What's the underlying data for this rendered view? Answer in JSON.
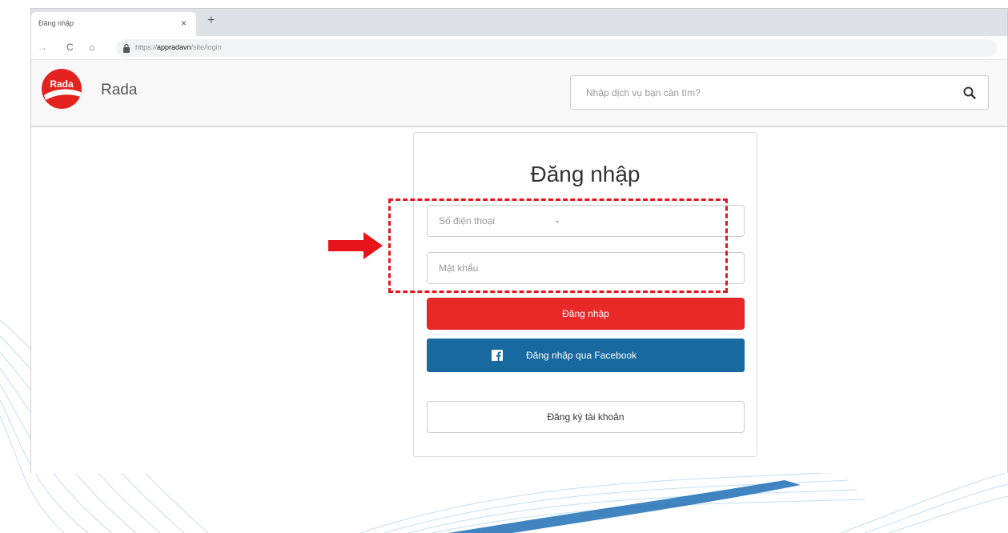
{
  "browser": {
    "tab_title": "Đăng nhập",
    "tab_close": "×",
    "new_tab": "+",
    "nav": {
      "back": "→",
      "reload": "C",
      "home": "⌂"
    },
    "url": {
      "prefix": "https://",
      "host": "appradavn",
      "path": "/site/login"
    }
  },
  "header": {
    "brand": "Rada",
    "logo_text": "Rada",
    "search": {
      "placeholder": "Nhập dịch vụ bạn cần tìm?"
    }
  },
  "login": {
    "title": "Đăng nhập",
    "phone_placeholder": "Số điện thoại",
    "password_placeholder": "Mật khẩu",
    "stray_mark": "`",
    "login_button": "Đăng nhập",
    "facebook_button": "Đăng nhập qua Facebook",
    "register_button": "Đăng ký tài khoản"
  },
  "icons": {
    "search": "search-icon",
    "lock": "lock-icon",
    "facebook": "facebook-icon",
    "logo": "rada-logo"
  },
  "colors": {
    "primary_red": "#e92828",
    "facebook_blue": "#1769a0",
    "annotation_red": "#e8141b"
  }
}
